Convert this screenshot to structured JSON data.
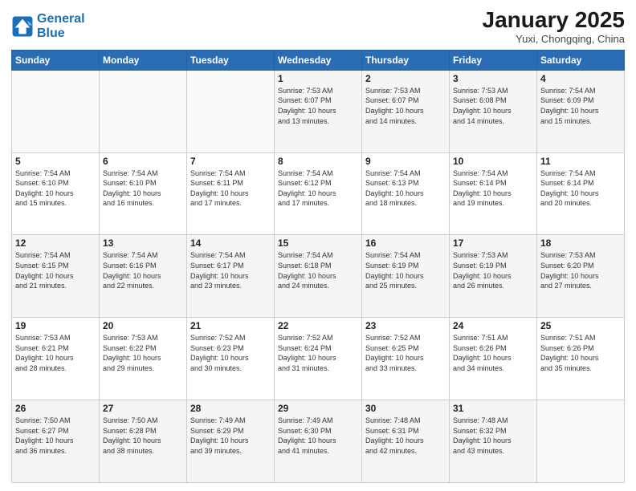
{
  "logo": {
    "line1": "General",
    "line2": "Blue"
  },
  "header": {
    "month": "January 2025",
    "location": "Yuxi, Chongqing, China"
  },
  "weekdays": [
    "Sunday",
    "Monday",
    "Tuesday",
    "Wednesday",
    "Thursday",
    "Friday",
    "Saturday"
  ],
  "weeks": [
    [
      {
        "day": "",
        "info": ""
      },
      {
        "day": "",
        "info": ""
      },
      {
        "day": "",
        "info": ""
      },
      {
        "day": "1",
        "info": "Sunrise: 7:53 AM\nSunset: 6:07 PM\nDaylight: 10 hours\nand 13 minutes."
      },
      {
        "day": "2",
        "info": "Sunrise: 7:53 AM\nSunset: 6:07 PM\nDaylight: 10 hours\nand 14 minutes."
      },
      {
        "day": "3",
        "info": "Sunrise: 7:53 AM\nSunset: 6:08 PM\nDaylight: 10 hours\nand 14 minutes."
      },
      {
        "day": "4",
        "info": "Sunrise: 7:54 AM\nSunset: 6:09 PM\nDaylight: 10 hours\nand 15 minutes."
      }
    ],
    [
      {
        "day": "5",
        "info": "Sunrise: 7:54 AM\nSunset: 6:10 PM\nDaylight: 10 hours\nand 15 minutes."
      },
      {
        "day": "6",
        "info": "Sunrise: 7:54 AM\nSunset: 6:10 PM\nDaylight: 10 hours\nand 16 minutes."
      },
      {
        "day": "7",
        "info": "Sunrise: 7:54 AM\nSunset: 6:11 PM\nDaylight: 10 hours\nand 17 minutes."
      },
      {
        "day": "8",
        "info": "Sunrise: 7:54 AM\nSunset: 6:12 PM\nDaylight: 10 hours\nand 17 minutes."
      },
      {
        "day": "9",
        "info": "Sunrise: 7:54 AM\nSunset: 6:13 PM\nDaylight: 10 hours\nand 18 minutes."
      },
      {
        "day": "10",
        "info": "Sunrise: 7:54 AM\nSunset: 6:14 PM\nDaylight: 10 hours\nand 19 minutes."
      },
      {
        "day": "11",
        "info": "Sunrise: 7:54 AM\nSunset: 6:14 PM\nDaylight: 10 hours\nand 20 minutes."
      }
    ],
    [
      {
        "day": "12",
        "info": "Sunrise: 7:54 AM\nSunset: 6:15 PM\nDaylight: 10 hours\nand 21 minutes."
      },
      {
        "day": "13",
        "info": "Sunrise: 7:54 AM\nSunset: 6:16 PM\nDaylight: 10 hours\nand 22 minutes."
      },
      {
        "day": "14",
        "info": "Sunrise: 7:54 AM\nSunset: 6:17 PM\nDaylight: 10 hours\nand 23 minutes."
      },
      {
        "day": "15",
        "info": "Sunrise: 7:54 AM\nSunset: 6:18 PM\nDaylight: 10 hours\nand 24 minutes."
      },
      {
        "day": "16",
        "info": "Sunrise: 7:54 AM\nSunset: 6:19 PM\nDaylight: 10 hours\nand 25 minutes."
      },
      {
        "day": "17",
        "info": "Sunrise: 7:53 AM\nSunset: 6:19 PM\nDaylight: 10 hours\nand 26 minutes."
      },
      {
        "day": "18",
        "info": "Sunrise: 7:53 AM\nSunset: 6:20 PM\nDaylight: 10 hours\nand 27 minutes."
      }
    ],
    [
      {
        "day": "19",
        "info": "Sunrise: 7:53 AM\nSunset: 6:21 PM\nDaylight: 10 hours\nand 28 minutes."
      },
      {
        "day": "20",
        "info": "Sunrise: 7:53 AM\nSunset: 6:22 PM\nDaylight: 10 hours\nand 29 minutes."
      },
      {
        "day": "21",
        "info": "Sunrise: 7:52 AM\nSunset: 6:23 PM\nDaylight: 10 hours\nand 30 minutes."
      },
      {
        "day": "22",
        "info": "Sunrise: 7:52 AM\nSunset: 6:24 PM\nDaylight: 10 hours\nand 31 minutes."
      },
      {
        "day": "23",
        "info": "Sunrise: 7:52 AM\nSunset: 6:25 PM\nDaylight: 10 hours\nand 33 minutes."
      },
      {
        "day": "24",
        "info": "Sunrise: 7:51 AM\nSunset: 6:26 PM\nDaylight: 10 hours\nand 34 minutes."
      },
      {
        "day": "25",
        "info": "Sunrise: 7:51 AM\nSunset: 6:26 PM\nDaylight: 10 hours\nand 35 minutes."
      }
    ],
    [
      {
        "day": "26",
        "info": "Sunrise: 7:50 AM\nSunset: 6:27 PM\nDaylight: 10 hours\nand 36 minutes."
      },
      {
        "day": "27",
        "info": "Sunrise: 7:50 AM\nSunset: 6:28 PM\nDaylight: 10 hours\nand 38 minutes."
      },
      {
        "day": "28",
        "info": "Sunrise: 7:49 AM\nSunset: 6:29 PM\nDaylight: 10 hours\nand 39 minutes."
      },
      {
        "day": "29",
        "info": "Sunrise: 7:49 AM\nSunset: 6:30 PM\nDaylight: 10 hours\nand 41 minutes."
      },
      {
        "day": "30",
        "info": "Sunrise: 7:48 AM\nSunset: 6:31 PM\nDaylight: 10 hours\nand 42 minutes."
      },
      {
        "day": "31",
        "info": "Sunrise: 7:48 AM\nSunset: 6:32 PM\nDaylight: 10 hours\nand 43 minutes."
      },
      {
        "day": "",
        "info": ""
      }
    ]
  ]
}
